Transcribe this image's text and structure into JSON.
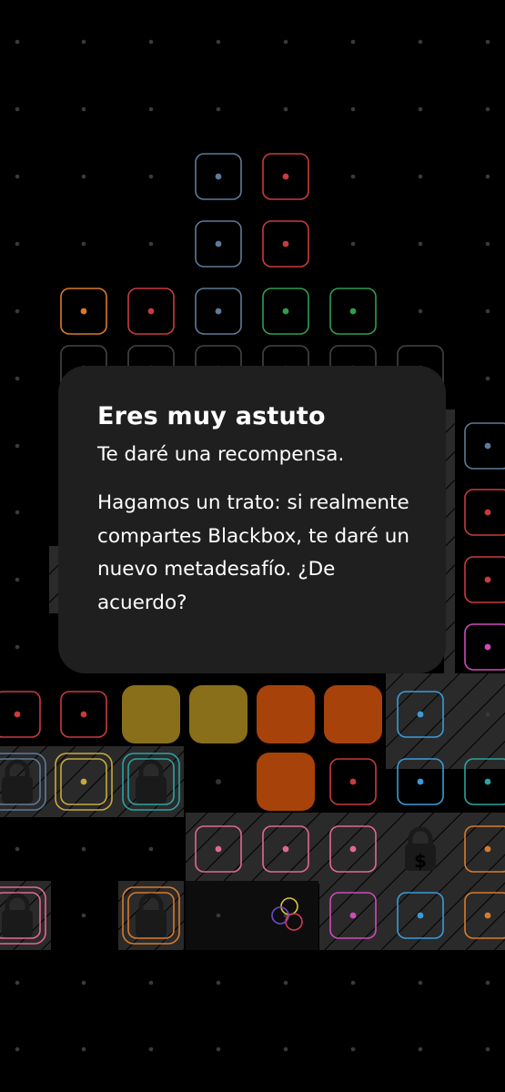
{
  "dialog": {
    "title": "Eres muy astuto",
    "subtitle": "Te daré una recompensa.",
    "body": "Hagamos un trato: si realmente compartes Blackbox, te daré un nuevo metadesafío. ¿De acuerdo?"
  },
  "colors": {
    "background": "#000000",
    "dialog": "#1f1f1f",
    "slate": "#5c7a99",
    "red": "#c93b3b",
    "orange": "#d97a2b",
    "green": "#2f9e4f",
    "pink": "#e06a8e",
    "magenta": "#d14ab8",
    "teal": "#2aa3a3",
    "yellow": "#c9a93b",
    "cyan": "#3a9bd9",
    "solid_olive": "#8a6f1b",
    "solid_orange": "#a8420b"
  },
  "icons": [
    "lock-icon",
    "dollar-lock-icon",
    "circles-icon"
  ]
}
